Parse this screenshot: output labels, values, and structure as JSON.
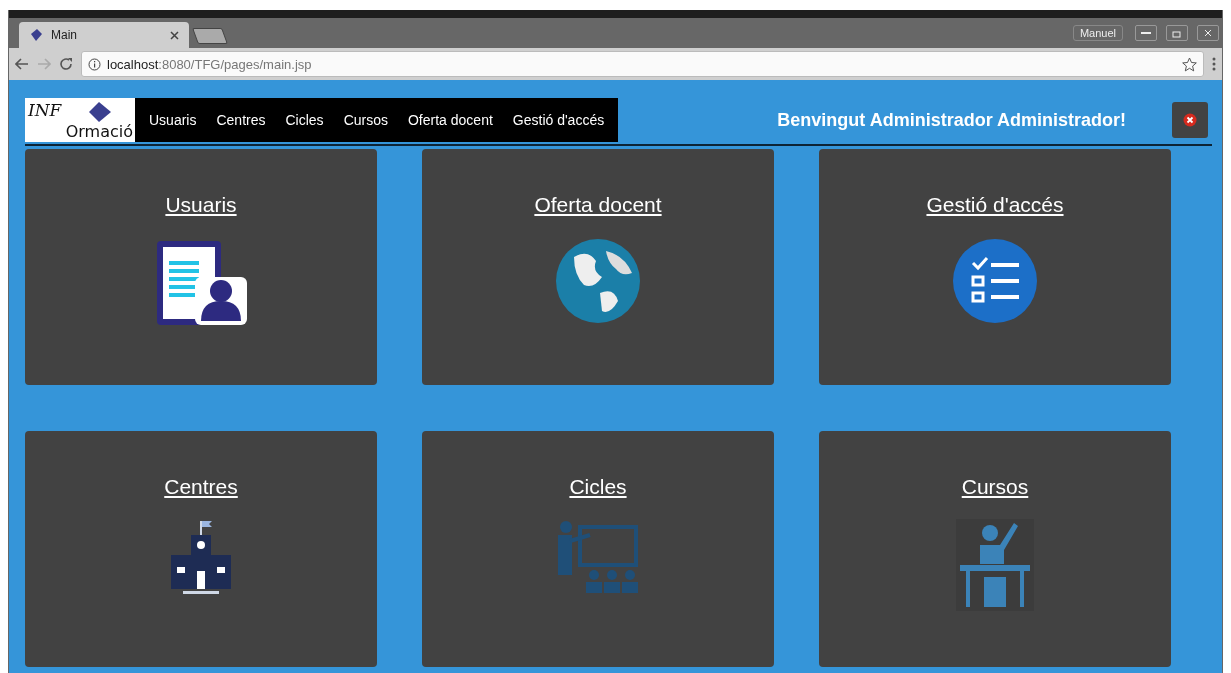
{
  "browser": {
    "tab": {
      "title": "Main",
      "selected": true
    },
    "profile": "Manuel",
    "url": {
      "host": "localhost",
      "path": ":8080/TFG/pages/main.jsp"
    }
  },
  "header": {
    "logo": {
      "top": "INF",
      "bottom": "Ormació"
    },
    "nav": [
      "Usuaris",
      "Centres",
      "Cicles",
      "Cursos",
      "Oferta docent",
      "Gestió d'accés"
    ],
    "welcome": "Benvingut Administrador Administrador!"
  },
  "cards": [
    {
      "title": "Usuaris",
      "kind": "document"
    },
    {
      "title": "Oferta docent",
      "kind": "globe"
    },
    {
      "title": "Gestió d'accés",
      "kind": "checklist"
    },
    {
      "title": "Centres",
      "kind": "school"
    },
    {
      "title": "Cicles",
      "kind": "teacher"
    },
    {
      "title": "Cursos",
      "kind": "student"
    }
  ]
}
